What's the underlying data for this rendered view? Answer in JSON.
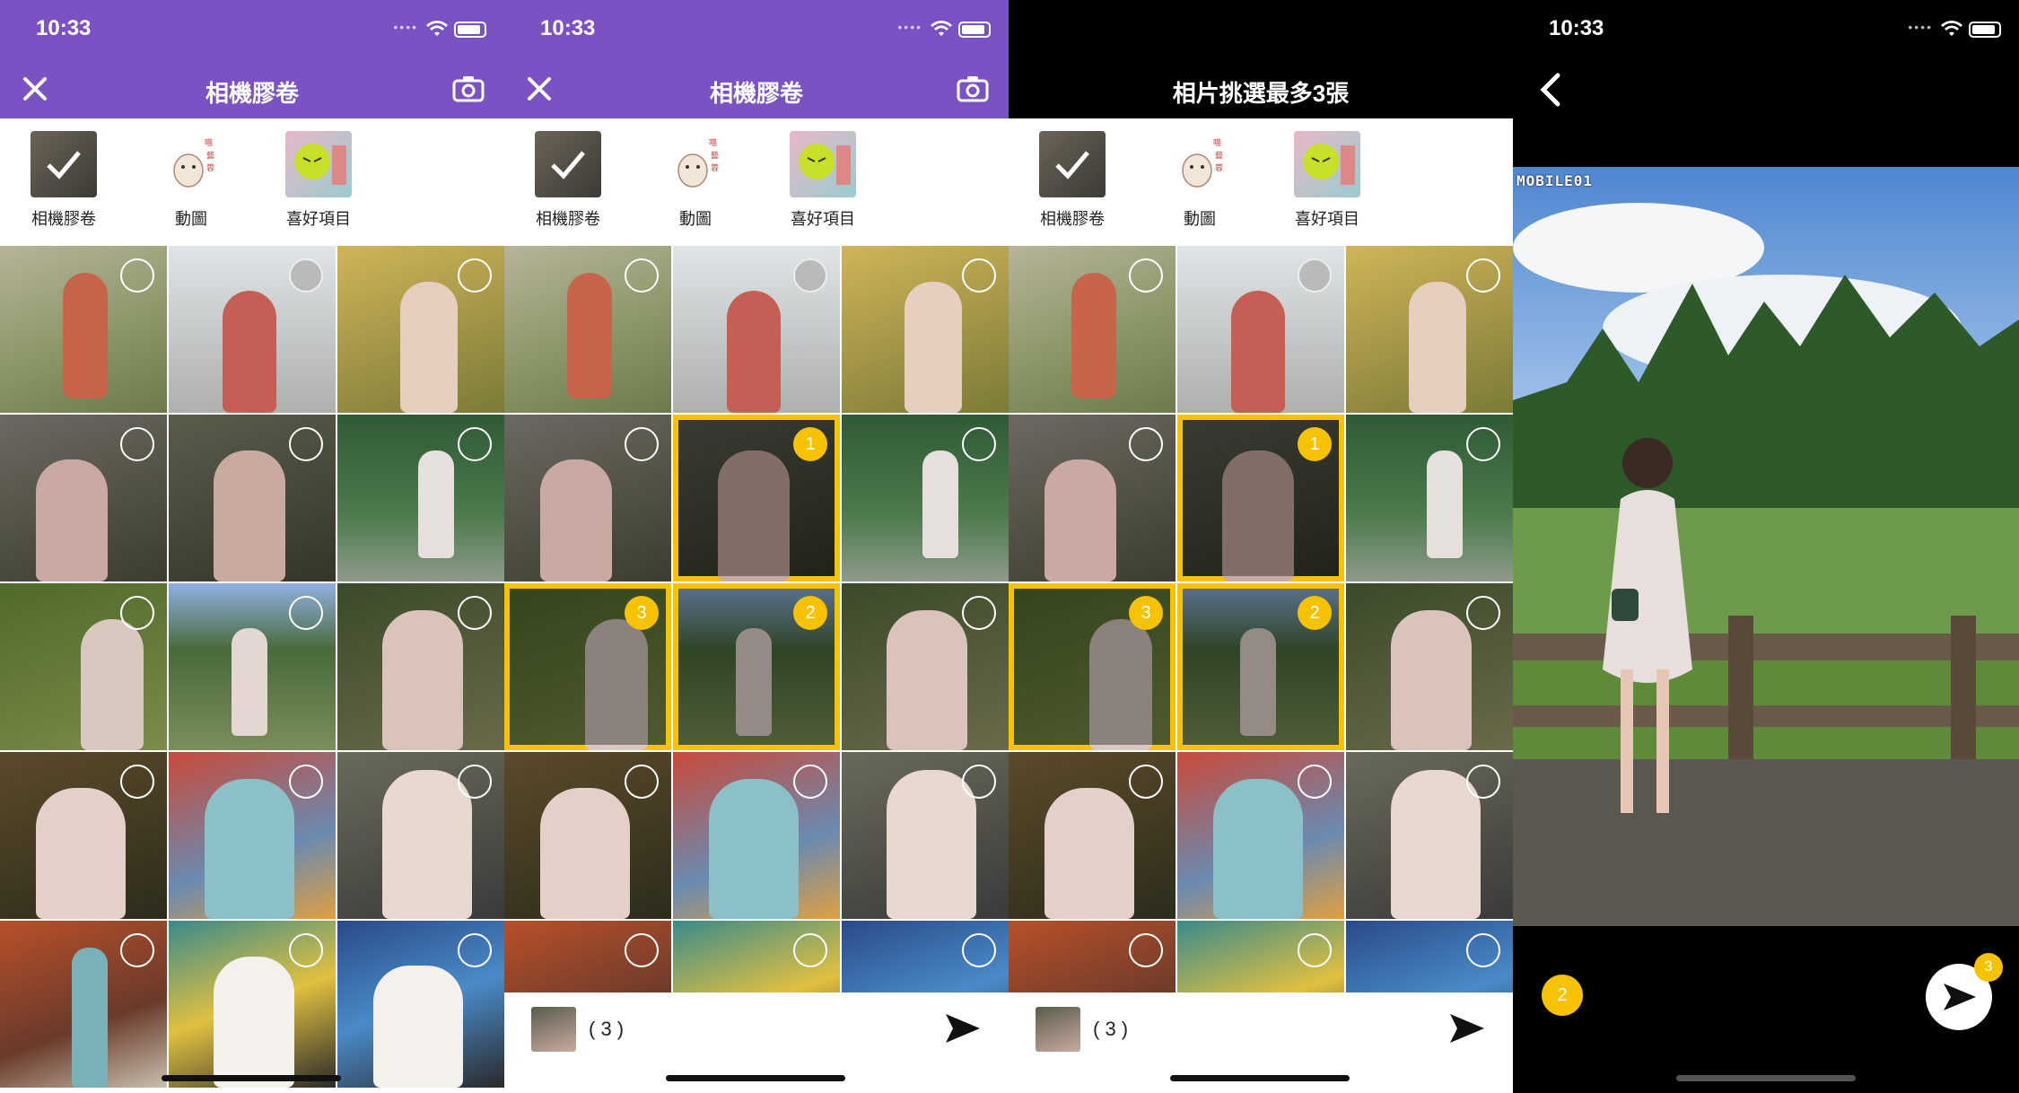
{
  "status": {
    "time": "10:33"
  },
  "picker": {
    "title": "相機膠卷",
    "albums": [
      {
        "label": "相機膠卷",
        "icon": "camera-roll-thumb"
      },
      {
        "label": "動圖",
        "icon": "gif-sticker-thumb"
      },
      {
        "label": "喜好項目",
        "icon": "favorites-thumb"
      }
    ]
  },
  "picker_limit": {
    "title": "相片挑選最多3張"
  },
  "selection": {
    "count_label": "( 3 )",
    "selected_order": [
      "1",
      "2",
      "3"
    ]
  },
  "viewer": {
    "watermark": "MOBILE01",
    "current_index": "2",
    "send_count": "3"
  },
  "colors": {
    "header_purple": "#7b52c3",
    "select_yellow": "#f7c300"
  }
}
